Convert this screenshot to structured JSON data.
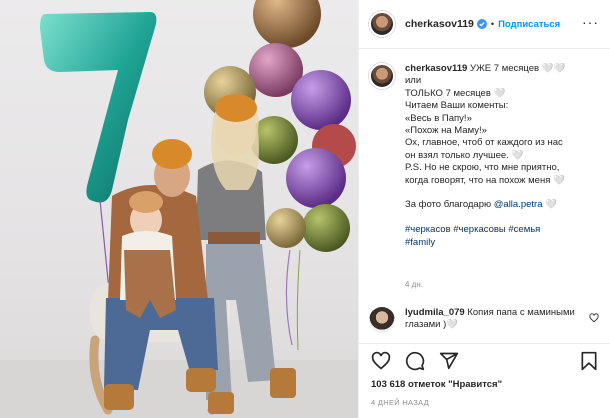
{
  "post": {
    "username": "cherkasov119",
    "follow_label": "Подписаться",
    "caption_lines": [
      "УЖЕ 7 месяцев 🤍🤍",
      "или",
      "ТОЛЬКО 7 месяцев 🤍",
      "Читаем Ваши коменты:",
      "«Весь в Папу!»",
      "«Похож на Маму!»",
      "Ох, главное, чтоб от каждого из нас",
      "он взял только лучшее. 🤍",
      "P.S. Но не скрою, что мне приятно,",
      "когда говорят, что на похож меня 🤍"
    ],
    "credit_prefix": "За фото благодарю ",
    "credit_mention": "@alla.petra",
    "credit_suffix": " 🤍",
    "hashtags_line1": "#черкасов #черкасовы #семья",
    "hashtags_line2": "#family",
    "caption_time": "4 дн.",
    "comment_user": "lyudmila_079",
    "comment_text": "Копия папа с мамиными глазами )🤍",
    "likes": "103 618 отметок \"Нравится\"",
    "date": "4 ДНЕЙ НАЗАД"
  },
  "icons": [
    "verified-icon",
    "heart-icon",
    "comment-icon",
    "share-icon",
    "bookmark-icon",
    "comment-like-icon",
    "more-options-icon"
  ],
  "colors": {
    "accent": "#0095f6",
    "link": "#00376b",
    "muted": "#8e8e8e",
    "text": "#262626"
  }
}
